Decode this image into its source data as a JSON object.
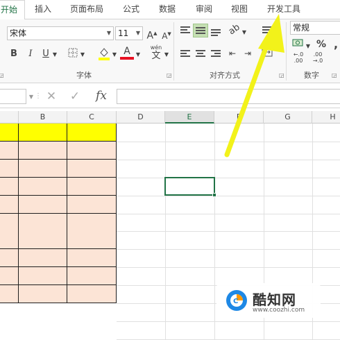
{
  "ribbon_tabs": [
    {
      "label": "开始",
      "active": true
    },
    {
      "label": "插入"
    },
    {
      "label": "页面布局"
    },
    {
      "label": "公式"
    },
    {
      "label": "数据"
    },
    {
      "label": "审阅"
    },
    {
      "label": "视图"
    },
    {
      "label": "开发工具"
    }
  ],
  "font_group": {
    "font_name": "宋体",
    "font_size": "11",
    "grow_font": "A",
    "shrink_font": "A",
    "bold": "B",
    "italic": "I",
    "underline": "U",
    "wen_label": "wén",
    "wen_char": "文",
    "font_color_letter": "A",
    "label": "字体"
  },
  "align_group": {
    "label": "对齐方式"
  },
  "number_group": {
    "format": "常规",
    "percent": "%",
    "comma": ",",
    "inc_decimal_top": "←.0",
    "inc_decimal_bottom": ".00",
    "dec_decimal_top": ".00",
    "dec_decimal_bottom": "→.0",
    "label": "数字"
  },
  "formula_bar": {
    "fx": "fx",
    "cancel": "✕",
    "confirm": "✓"
  },
  "columns": [
    "B",
    "C",
    "D",
    "E",
    "F",
    "G",
    "H"
  ],
  "selected_column": "E",
  "watermark": {
    "name": "酷知网",
    "url": "www.coozhi.com"
  },
  "colors": {
    "accent": "#217346",
    "header_fill": "#ffff00",
    "body_fill": "#fce4d6",
    "arrow": "#f2f21a"
  }
}
